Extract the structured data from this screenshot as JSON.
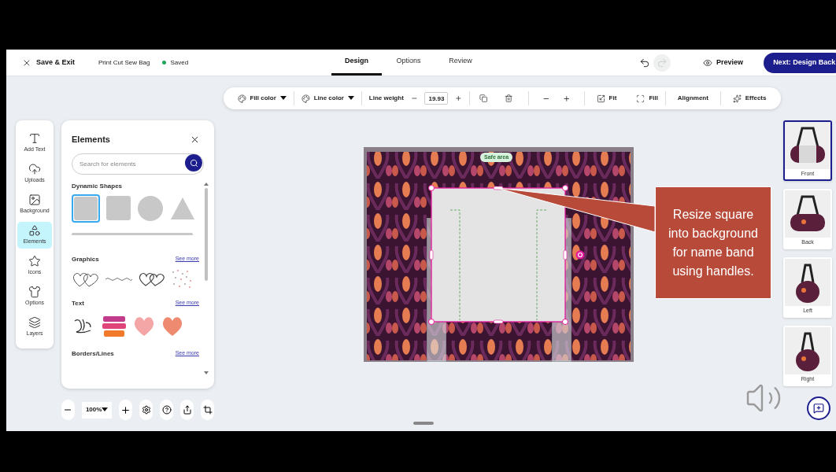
{
  "header": {
    "close_label": "Save & Exit",
    "project": "Print Cut Sew Bag",
    "status": "Saved",
    "tabs": [
      {
        "label": "Design",
        "selected": true
      },
      {
        "label": "Options",
        "selected": false
      },
      {
        "label": "Review",
        "selected": false
      }
    ],
    "redo_disabled": true,
    "preview": "Preview",
    "next": "Next: Design Back"
  },
  "toolbar": {
    "fill_color": "Fill color",
    "line_color": "Line color",
    "line_weight": {
      "label": "Line weight",
      "value": "19.93"
    },
    "fit": "Fit",
    "fill": "Fill",
    "alignment": "Alignment",
    "effects": "Effects"
  },
  "rail": [
    {
      "label": "Add Text",
      "selected": false
    },
    {
      "label": "Uploads",
      "selected": false
    },
    {
      "label": "Background",
      "selected": false
    },
    {
      "label": "Elements",
      "selected": true
    },
    {
      "label": "Icons",
      "selected": false
    },
    {
      "label": "Options",
      "selected": false
    },
    {
      "label": "Layers",
      "selected": false
    }
  ],
  "panel": {
    "title": "Elements",
    "search_placeholder": "Search for elements",
    "shapes_title": "Dynamic Shapes",
    "shapes": [
      {
        "kind": "rounded-square",
        "selected": true
      },
      {
        "kind": "square",
        "selected": false
      },
      {
        "kind": "circle",
        "selected": false
      },
      {
        "kind": "triangle",
        "selected": false
      },
      {
        "kind": "line",
        "selected": false
      }
    ],
    "sections": [
      {
        "title": "Graphics",
        "link": "See more",
        "kind": "graphics"
      },
      {
        "title": "Text",
        "link": "See more",
        "kind": "stickers"
      },
      {
        "title": "Borders/Lines",
        "link": "See more",
        "kind": "none"
      }
    ]
  },
  "canvas": {
    "safe_area": "Safe area"
  },
  "callout": "Resize square into background for name band using handles.",
  "views": [
    {
      "label": "Front",
      "selected": true
    },
    {
      "label": "Back",
      "selected": false
    },
    {
      "label": "Left",
      "selected": false
    },
    {
      "label": "Right",
      "selected": false
    }
  ],
  "zoom": "100%"
}
